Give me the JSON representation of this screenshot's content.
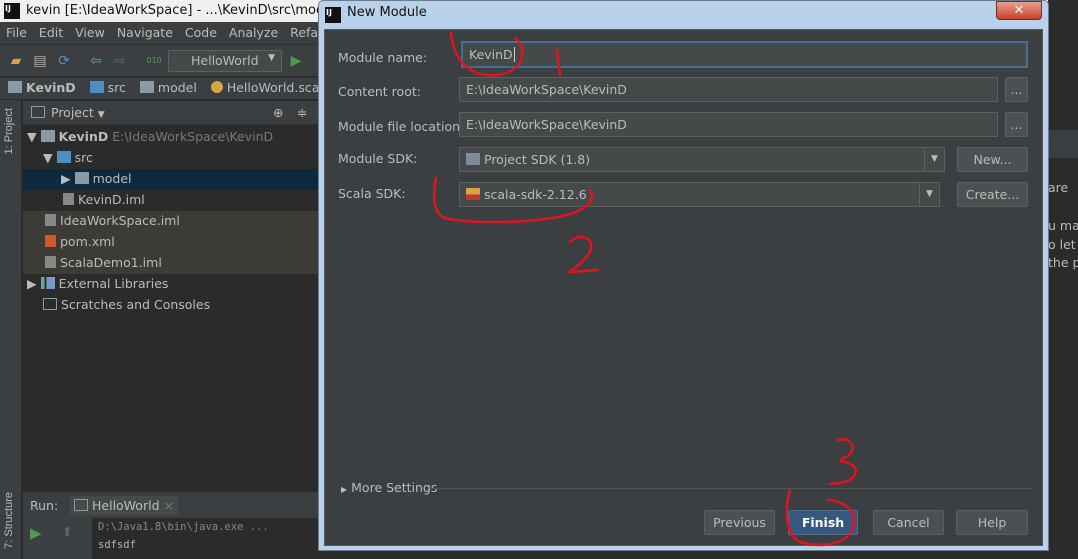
{
  "window": {
    "title": "kevin [E:\\IdeaWorkSpace] - ...\\KevinD\\src\\model\\He",
    "logo": "IJ"
  },
  "menu": [
    "File",
    "Edit",
    "View",
    "Navigate",
    "Code",
    "Analyze",
    "Refacto"
  ],
  "toolbar": {
    "run_config": "HelloWorld"
  },
  "breadcrumbs": [
    "KevinD",
    "src",
    "model",
    "HelloWorld.scala"
  ],
  "side_tabs": {
    "project": "1: Project",
    "structure": "7: Structure"
  },
  "project_panel": {
    "title": "Project",
    "tree": [
      {
        "label": "KevinD",
        "hint": "E:\\IdeaWorkSpace\\KevinD",
        "icon": "module-folder-icon"
      },
      {
        "label": "src",
        "icon": "source-folder-icon"
      },
      {
        "label": "model",
        "icon": "package-icon"
      },
      {
        "label": "KevinD.iml",
        "icon": "iml-file-icon"
      },
      {
        "label": "IdeaWorkSpace.iml",
        "icon": "iml-file-icon"
      },
      {
        "label": "pom.xml",
        "icon": "maven-file-icon"
      },
      {
        "label": "ScalaDemo1.iml",
        "icon": "iml-file-icon"
      },
      {
        "label": "External Libraries",
        "icon": "libraries-icon"
      },
      {
        "label": "Scratches and Consoles",
        "icon": "scratches-icon"
      }
    ]
  },
  "right_text": [
    "are",
    "u ma",
    "o let",
    "the p"
  ],
  "run_panel": {
    "label": "Run:",
    "tab": "HelloWorld",
    "console": [
      "D:\\Java1.8\\bin\\java.exe ...",
      "sdfsdf"
    ]
  },
  "dialog": {
    "title": "New Module",
    "logo": "IJ",
    "close": "✕",
    "fields": {
      "module_name": {
        "label": "Module name:",
        "value": "KevinD"
      },
      "content_root": {
        "label": "Content root:",
        "value": "E:\\IdeaWorkSpace\\KevinD",
        "browse": "..."
      },
      "module_file_location": {
        "label": "Module file location:",
        "value": "E:\\IdeaWorkSpace\\KevinD",
        "browse": "..."
      },
      "module_sdk": {
        "label": "Module SDK:",
        "value": "Project SDK (1.8)",
        "button": "New..."
      },
      "scala_sdk": {
        "label": "Scala SDK:",
        "value": "scala-sdk-2.12.6",
        "button": "Create..."
      }
    },
    "more_settings": "More Settings",
    "buttons": {
      "previous": "Previous",
      "finish": "Finish",
      "cancel": "Cancel",
      "help": "Help"
    }
  },
  "annotations": {
    "color": "#e0141e",
    "marks": [
      "1",
      "2",
      "3"
    ]
  }
}
